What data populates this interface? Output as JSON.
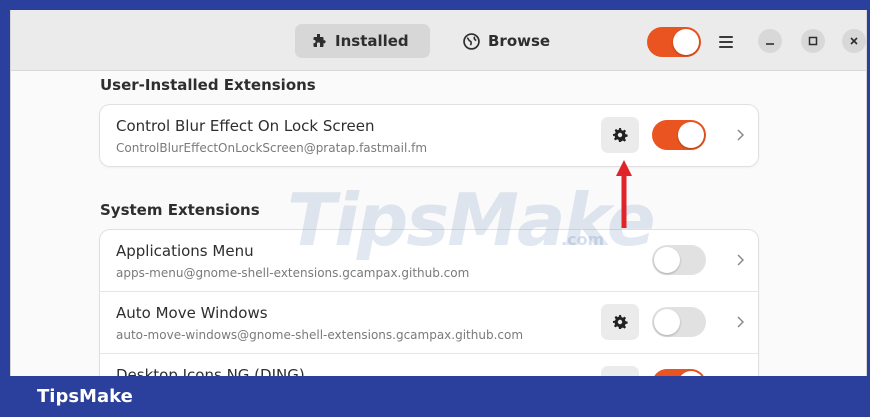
{
  "header": {
    "tabs": [
      {
        "label": "Installed",
        "icon": "puzzle-icon",
        "active": true
      },
      {
        "label": "Browse",
        "icon": "globe-icon",
        "active": false
      }
    ],
    "extensions_toggle_on": true,
    "window_controls": [
      "menu-icon",
      "minimize-icon",
      "maximize-icon",
      "close-icon"
    ]
  },
  "sections": [
    {
      "title": "User-Installed Extensions",
      "items": [
        {
          "name": "Control Blur Effect On Lock Screen",
          "uuid": "ControlBlurEffectOnLockScreen@pratap.fastmail.fm",
          "has_settings": true,
          "enabled": true
        }
      ]
    },
    {
      "title": "System Extensions",
      "items": [
        {
          "name": "Applications Menu",
          "uuid": "apps-menu@gnome-shell-extensions.gcampax.github.com",
          "has_settings": false,
          "enabled": false
        },
        {
          "name": "Auto Move Windows",
          "uuid": "auto-move-windows@gnome-shell-extensions.gcampax.github.com",
          "has_settings": true,
          "enabled": false
        },
        {
          "name": "Desktop Icons NG (DING)",
          "uuid": "",
          "has_settings": true,
          "enabled": true
        }
      ]
    }
  ],
  "watermark": {
    "text": "TipsMake",
    "suffix": ".com"
  },
  "banner": {
    "text": "TipsMake"
  },
  "colors": {
    "accent": "#e95420",
    "banner": "#2b3f9c",
    "annotation_arrow": "#e0242a"
  }
}
